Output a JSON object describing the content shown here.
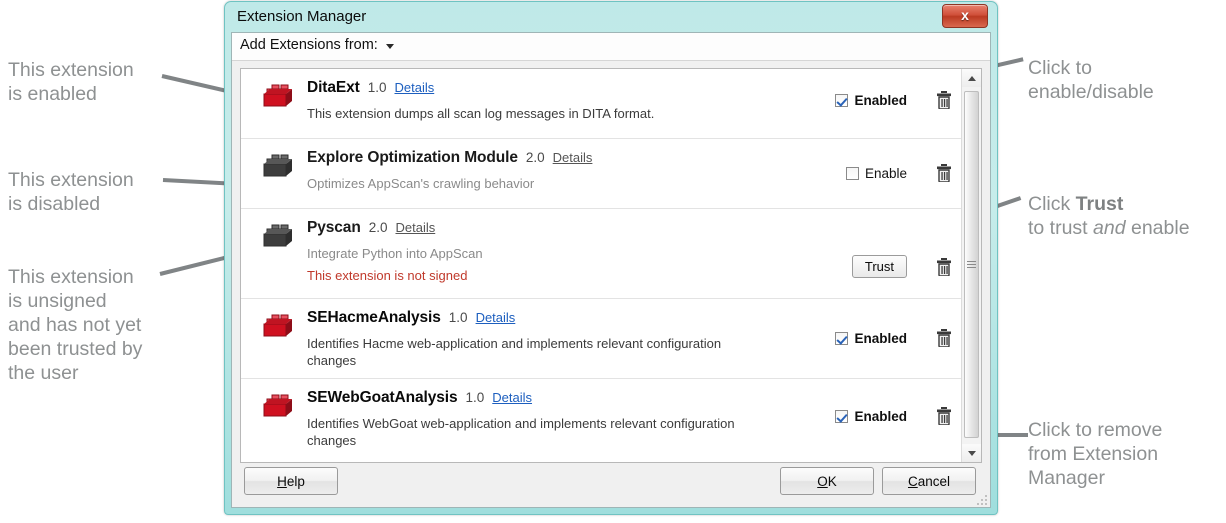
{
  "window": {
    "title": "Extension Manager",
    "close_label": "x",
    "toolbar": {
      "add_label": "Add Extensions from:",
      "caret_icon": "chevron-down-icon"
    },
    "buttons": {
      "help": {
        "prefix": "",
        "accel": "H",
        "suffix": "elp"
      },
      "ok": {
        "prefix": "",
        "accel": "O",
        "suffix": "K"
      },
      "cancel": {
        "prefix": "",
        "accel": "C",
        "suffix": "ancel"
      }
    }
  },
  "extensions": [
    {
      "name": "DitaExt",
      "version": "1.0",
      "details_label": "Details",
      "description": "This extension dumps all scan log messages in DITA format.",
      "warning": "",
      "state": "enabled",
      "control": "checkbox",
      "checkbox_label": "Enabled",
      "checked": true,
      "icon": "extension-brick-icon-red",
      "delete_icon": "trash-icon"
    },
    {
      "name": "Explore Optimization Module",
      "version": "2.0",
      "details_label": "Details",
      "description": "Optimizes AppScan's crawling behavior",
      "warning": "",
      "state": "disabled",
      "control": "checkbox",
      "checkbox_label": "Enable",
      "checked": false,
      "icon": "extension-brick-icon-gray",
      "delete_icon": "trash-icon"
    },
    {
      "name": "Pyscan",
      "version": "2.0",
      "details_label": "Details",
      "description": "Integrate Python into AppScan",
      "warning": "This extension is not signed",
      "state": "untrusted",
      "control": "button",
      "button_label": "Trust",
      "checked": false,
      "icon": "extension-brick-icon-gray",
      "delete_icon": "trash-icon"
    },
    {
      "name": "SEHacmeAnalysis",
      "version": "1.0",
      "details_label": "Details",
      "description": "Identifies Hacme web-application and implements relevant configuration changes",
      "warning": "",
      "state": "enabled",
      "control": "checkbox",
      "checkbox_label": "Enabled",
      "checked": true,
      "icon": "extension-brick-icon-red",
      "delete_icon": "trash-icon"
    },
    {
      "name": "SEWebGoatAnalysis",
      "version": "1.0",
      "details_label": "Details",
      "description": "Identifies WebGoat web-application and implements relevant configuration changes",
      "warning": "",
      "state": "enabled",
      "control": "checkbox",
      "checkbox_label": "Enabled",
      "checked": true,
      "icon": "extension-brick-icon-red",
      "delete_icon": "trash-icon"
    }
  ],
  "annotations": {
    "left": [
      {
        "text": "This extension\nis enabled"
      },
      {
        "text": "This extension\nis disabled"
      },
      {
        "text": "This extension\nis unsigned\nand has not yet\nbeen trusted by\nthe user"
      }
    ],
    "right": [
      {
        "text": "Click to\nenable/disable"
      },
      {
        "html": "Click <b>Trust</b><br>to trust <i>and</i> enable"
      },
      {
        "text": "Click to remove\nfrom Extension\nManager"
      }
    ]
  },
  "colors": {
    "frame": "#b9e7e6",
    "accent_link": "#1d5fbf",
    "warning": "#c0392b",
    "annotation": "#8e9192",
    "icon_enabled": "#cf1020",
    "icon_disabled": "#4a4a4a"
  }
}
